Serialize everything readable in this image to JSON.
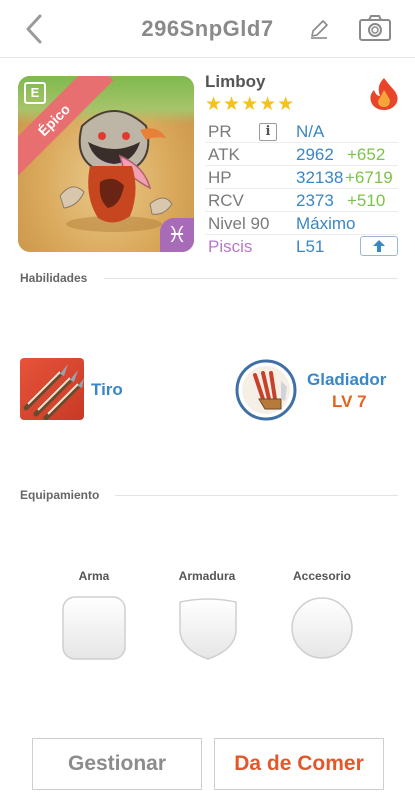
{
  "header": {
    "title": "296SnpGld7",
    "back_icon": "chevron-left-icon",
    "edit_icon": "pencil-icon",
    "camera_icon": "camera-icon"
  },
  "hero": {
    "rarity": "Épico",
    "name": "Limboy",
    "stars": "★★★★★",
    "element_icon": "fire-icon",
    "zodiac_symbol": "♓"
  },
  "stats": {
    "pr": {
      "label": "PR",
      "value": "N/A"
    },
    "atk": {
      "label": "ATK",
      "value": "2962",
      "bonus": "+652"
    },
    "hp": {
      "label": "HP",
      "value": "32138",
      "bonus": "+6719"
    },
    "rcv": {
      "label": "RCV",
      "value": "2373",
      "bonus": "+510"
    },
    "level": {
      "label": "Nivel 90",
      "value": "Máximo"
    },
    "zodiac": {
      "label": "Piscis",
      "value": "L51"
    }
  },
  "skills": {
    "section_label": "Habilidades",
    "skill_name": "Tiro",
    "class_name": "Gladiador",
    "class_level": "LV 7"
  },
  "equipment": {
    "section_label": "Equipamiento",
    "weapon_label": "Arma",
    "armor_label": "Armadura",
    "accessory_label": "Accesorio"
  },
  "actions": {
    "manage_label": "Gestionar",
    "feed_label": "Da de Comer"
  },
  "colors": {
    "accent_blue": "#3b86c6",
    "bonus_green": "#7dc24b",
    "feed_orange": "#e2582b",
    "rarity_red": "#e86f6f",
    "zodiac_purple": "#b878c8",
    "star_yellow": "#f4c21a"
  }
}
